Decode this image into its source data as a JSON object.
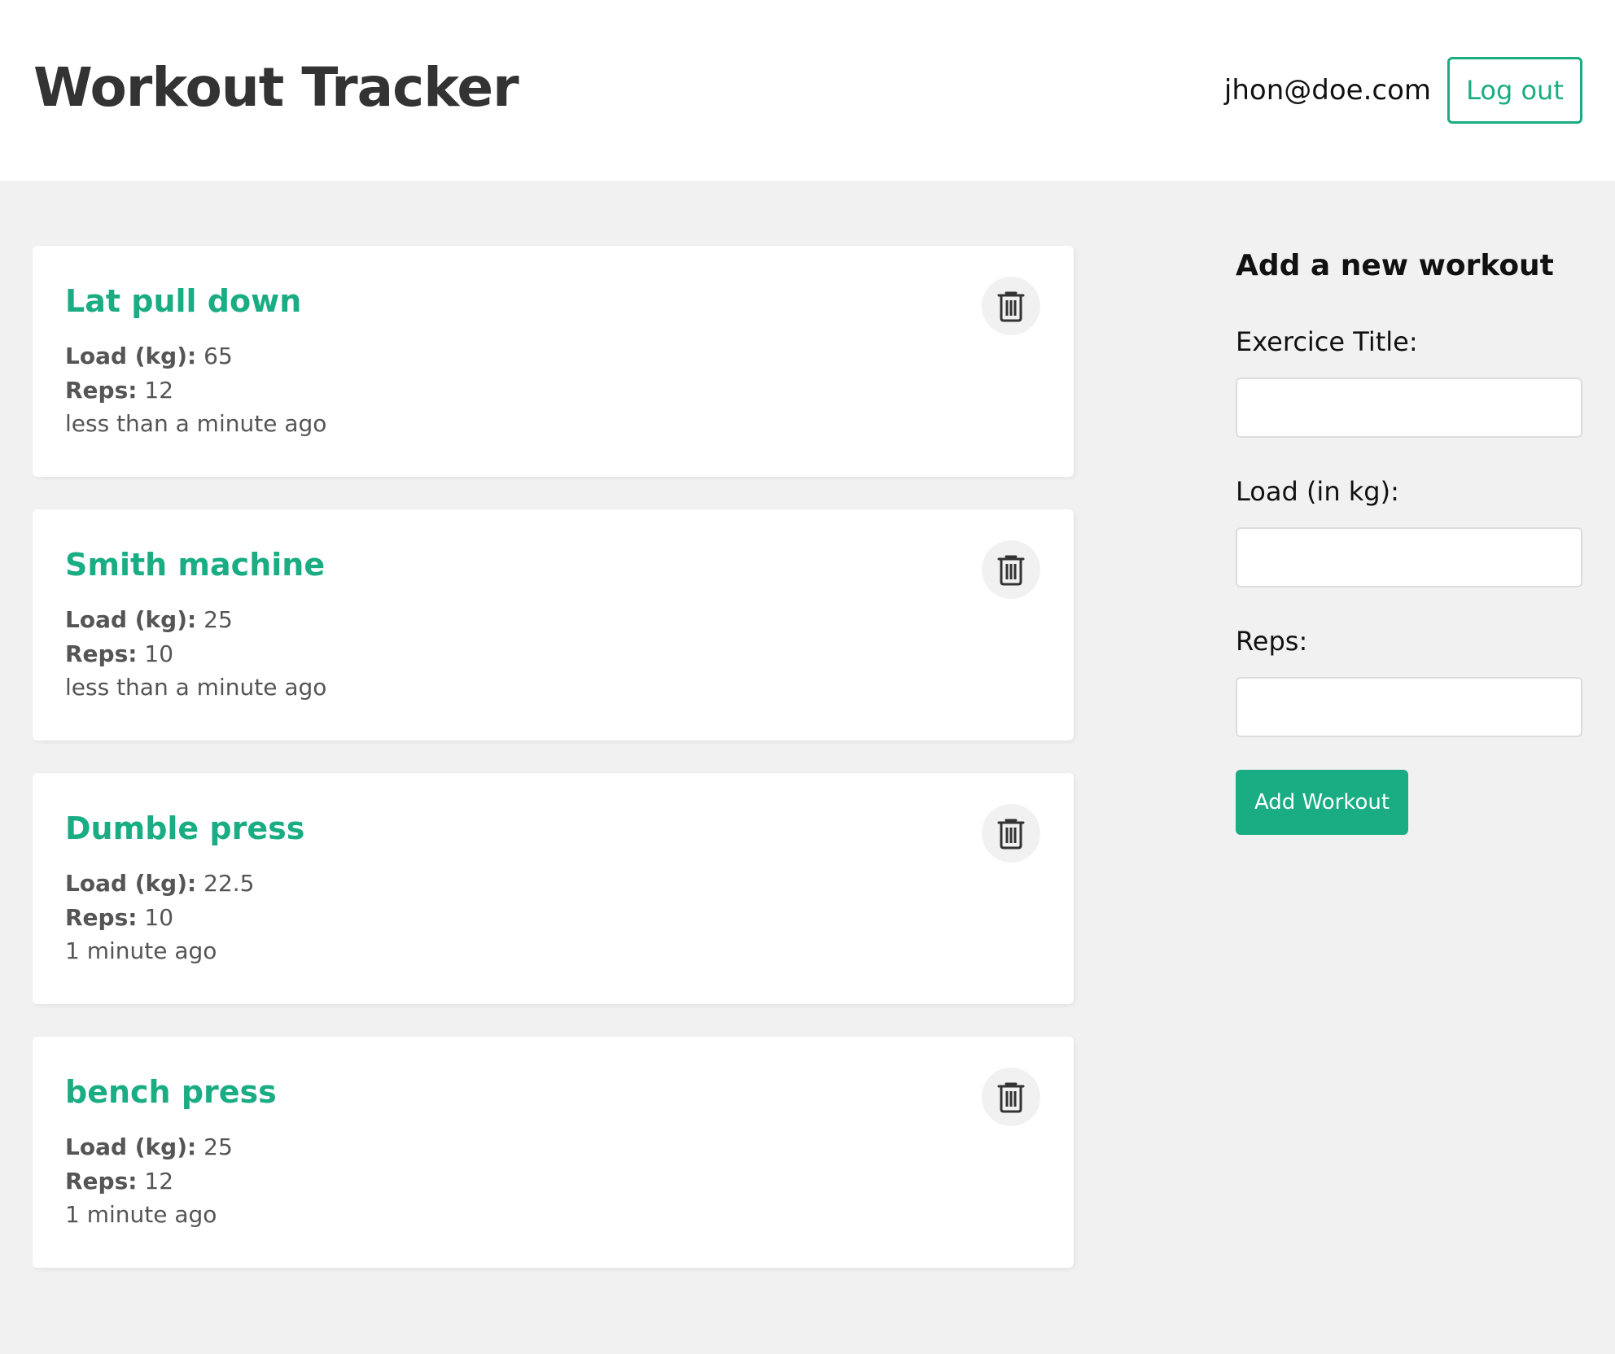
{
  "header": {
    "title": "Workout Tracker",
    "user_email": "jhon@doe.com",
    "logout_label": "Log out"
  },
  "workouts": [
    {
      "title": "Lat pull down",
      "load_label": "Load (kg):",
      "load": "65",
      "reps_label": "Reps:",
      "reps": "12",
      "time": "less than a minute ago",
      "delete_icon": "trash-icon"
    },
    {
      "title": "Smith machine",
      "load_label": "Load (kg):",
      "load": "25",
      "reps_label": "Reps:",
      "reps": "10",
      "time": "less than a minute ago",
      "delete_icon": "trash-icon"
    },
    {
      "title": "Dumble press",
      "load_label": "Load (kg):",
      "load": "22.5",
      "reps_label": "Reps:",
      "reps": "10",
      "time": "1 minute ago",
      "delete_icon": "trash-icon"
    },
    {
      "title": "bench press",
      "load_label": "Load (kg):",
      "load": "25",
      "reps_label": "Reps:",
      "reps": "12",
      "time": "1 minute ago",
      "delete_icon": "trash-icon"
    }
  ],
  "form": {
    "heading": "Add a new workout",
    "title_label": "Exercice Title:",
    "title_value": "",
    "load_label": "Load (in kg):",
    "load_value": "",
    "reps_label": "Reps:",
    "reps_value": "",
    "submit_label": "Add Workout"
  },
  "colors": {
    "accent": "#1aac83",
    "background": "#f1f1f1",
    "card": "#ffffff",
    "text": "#333333"
  }
}
